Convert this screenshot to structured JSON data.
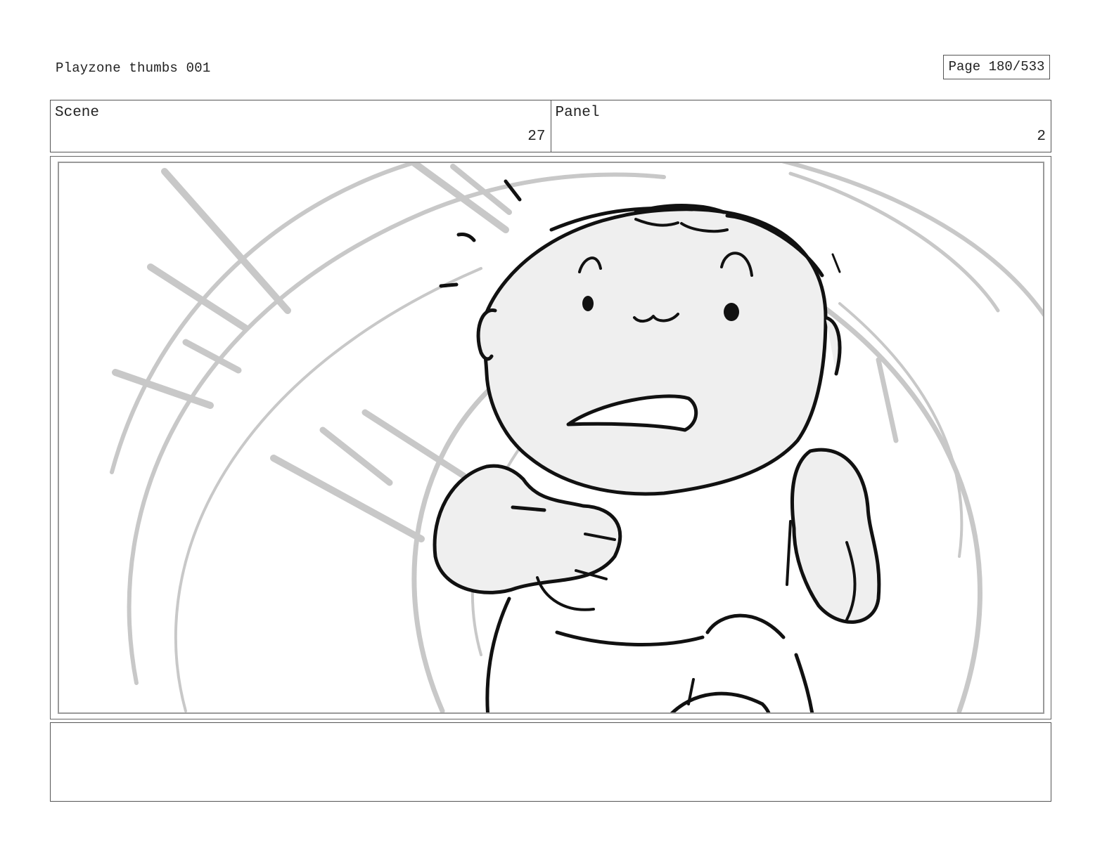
{
  "header": {
    "title": "Playzone thumbs 001",
    "page": "Page 180/533"
  },
  "scene": {
    "label": "Scene",
    "value": "27"
  },
  "panel": {
    "label": "Panel",
    "value": "2"
  },
  "notes": {
    "text": ""
  },
  "colors": {
    "border": "#555555",
    "sketch_line": "#111111",
    "sketch_fill": "#efefef",
    "rough_lines": "#c8c8c8"
  }
}
